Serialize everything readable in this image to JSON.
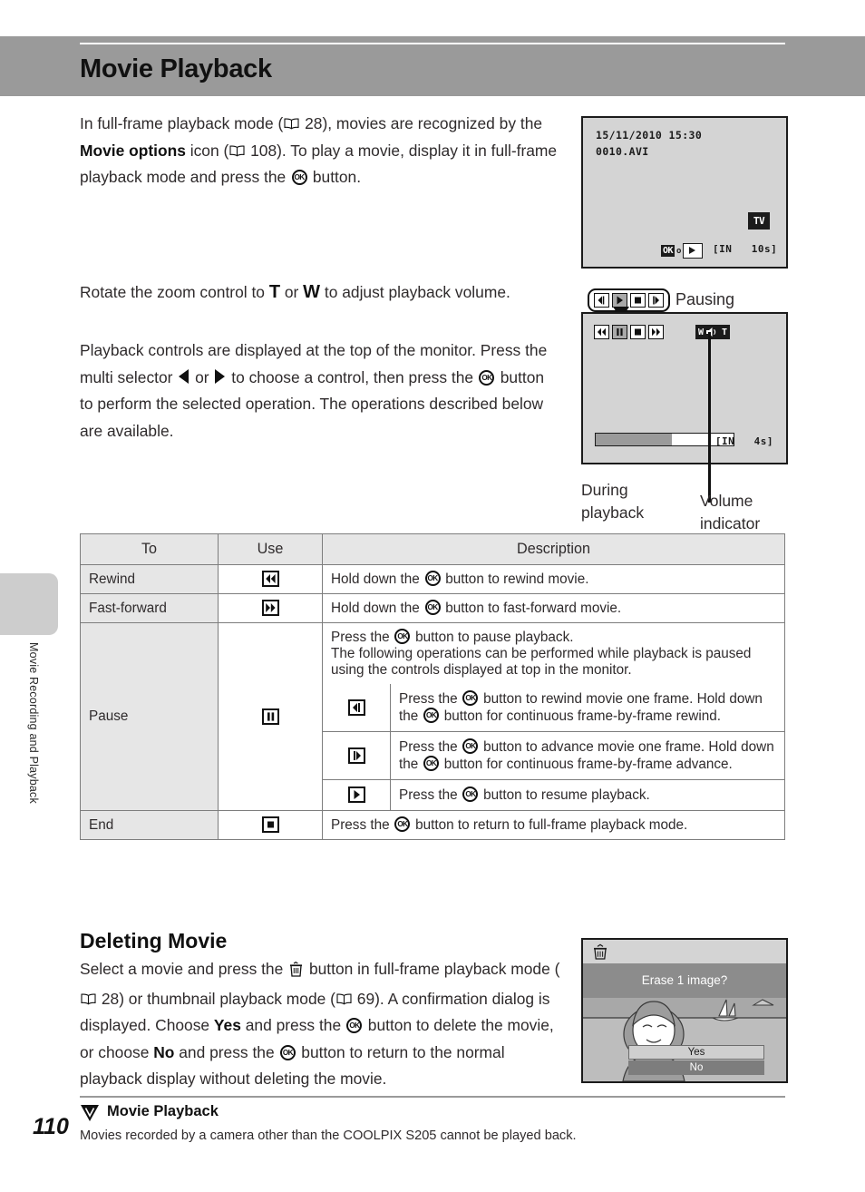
{
  "page": {
    "title": "Movie Playback",
    "number": "110",
    "side_tab_label": "Movie Recording and Playback"
  },
  "intro": {
    "p1_a": "In full-frame playback mode (",
    "p1_ref1": "28",
    "p1_b": "), movies are recognized by the ",
    "p1_bold": "Movie options",
    "p1_c": " icon (",
    "p1_ref2": "108",
    "p1_d": "). To play a movie, display it in full-frame playback mode and press the ",
    "p1_e": " button."
  },
  "zoom_para": {
    "a": "Rotate the zoom control to ",
    "t": "T",
    "b": " or ",
    "w": "W",
    "c": " to adjust playback volume."
  },
  "controls_para": {
    "a": "Playback controls are displayed at the top of the monitor. Press the multi selector ",
    "b": " or ",
    "c": " to choose a control, then press the ",
    "d": " button to perform the selected operation. The operations described below are available."
  },
  "screen1": {
    "datetime": "15/11/2010 15:30",
    "filename": "0010.AVI",
    "tv_icon_label": "TV",
    "ok_badge": "OK",
    "separator": "o",
    "duration": "10s",
    "memory_icon": "IN"
  },
  "screen2": {
    "callout_label": "Pausing",
    "callout_controls": [
      "frame-rewind",
      "play",
      "stop",
      "frame-advance"
    ],
    "callout_selected_index": 1,
    "screen_controls": [
      "rewind",
      "pause",
      "stop",
      "fast-forward"
    ],
    "screen_selected_index": 1,
    "volume_w": "W",
    "volume_t": "T",
    "progress_percent": 55,
    "duration": "4s",
    "memory_icon": "IN",
    "caption_during": "During\nplayback",
    "caption_during_line1": "During",
    "caption_during_line2": "playback",
    "caption_volume_line1": "Volume",
    "caption_volume_line2": "indicator"
  },
  "table": {
    "headers": {
      "to": "To",
      "use": "Use",
      "description": "Description"
    },
    "rows": [
      {
        "to": "Rewind",
        "use_icon": "rewind-icon",
        "description_a": "Hold down the ",
        "description_b": " button to rewind movie."
      },
      {
        "to": "Fast-forward",
        "use_icon": "fast-forward-icon",
        "description_a": "Hold down the ",
        "description_b": " button to fast-forward movie."
      },
      {
        "to": "Pause",
        "use_icon": "pause-icon",
        "description_a": "Press the ",
        "description_b": " button to pause playback.",
        "description_c": "The following operations can be performed while playback is paused using the controls displayed at top in the monitor.",
        "sub_rows": [
          {
            "icon": "frame-rewind-icon",
            "a": "Press the ",
            "b": " button to rewind movie one frame. Hold down the ",
            "c": " button for continuous frame-by-frame rewind."
          },
          {
            "icon": "frame-advance-icon",
            "a": "Press the ",
            "b": " button to advance movie one frame. Hold down the ",
            "c": " button for continuous frame-by-frame advance."
          },
          {
            "icon": "play-icon",
            "a": "Press the ",
            "b": " button to resume playback.",
            "c": ""
          }
        ]
      },
      {
        "to": "End",
        "use_icon": "stop-icon",
        "description_a": "Press the ",
        "description_b": " button to return to full-frame playback mode."
      }
    ]
  },
  "deleting": {
    "heading": "Deleting Movie",
    "a": "Select a movie and press the ",
    "b": " button in full-frame playback mode (",
    "ref1": "28",
    "c": ") or thumbnail playback mode (",
    "ref2": "69",
    "d": "). A confirmation dialog is displayed. Choose ",
    "yes": "Yes",
    "e": " and press the ",
    "f": " button to delete the movie, or choose ",
    "no": "No",
    "g": " and press the ",
    "h": " button to return to the normal playback display without deleting the movie."
  },
  "delete_dialog": {
    "prompt": "Erase 1 image?",
    "yes_label": "Yes",
    "no_label": "No",
    "selected": "Yes"
  },
  "footnote": {
    "mark": "caution-icon",
    "title": "Movie Playback",
    "body": "Movies recorded by a camera other than the COOLPIX S205 cannot be played back."
  },
  "colors": {
    "header_band": "#9a9a9a",
    "table_shade": "#e6e6e6",
    "screen_bg": "#d4d4d4",
    "rule": "#7d7d7d"
  }
}
